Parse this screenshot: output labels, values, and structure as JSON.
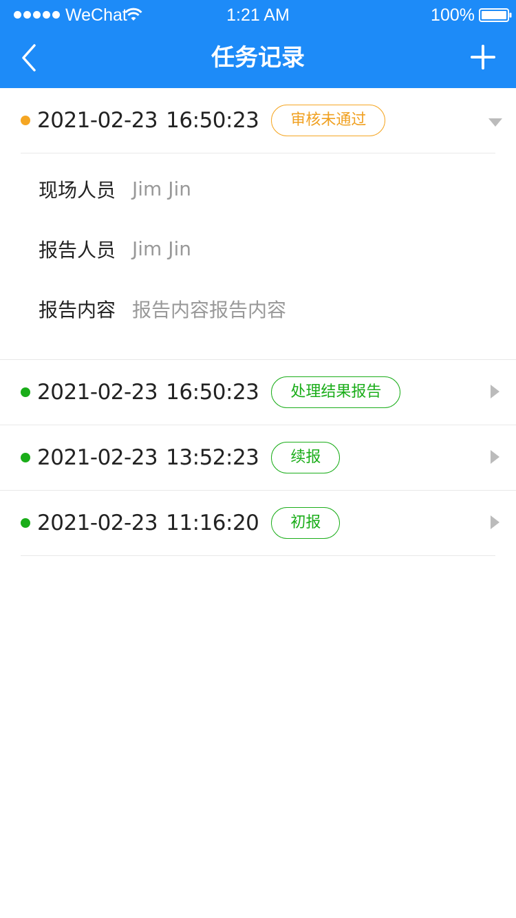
{
  "status_bar": {
    "carrier": "WeChat",
    "time": "1:21 AM",
    "battery": "100%"
  },
  "nav": {
    "title": "任务记录"
  },
  "records": [
    {
      "date": "2021-02-23",
      "time": "16:50:23",
      "badge": "审核未通过",
      "status_color": "#F5A623",
      "expanded": true
    },
    {
      "date": "2021-02-23",
      "time": "16:50:23",
      "badge": "处理结果报告",
      "status_color": "#1AAD19",
      "expanded": false
    },
    {
      "date": "2021-02-23",
      "time": "13:52:23",
      "badge": "续报",
      "status_color": "#1AAD19",
      "expanded": false
    },
    {
      "date": "2021-02-23",
      "time": "11:16:20",
      "badge": "初报",
      "status_color": "#1AAD19",
      "expanded": false
    }
  ],
  "details": [
    {
      "label": "现场人员",
      "value": "Jim Jin"
    },
    {
      "label": "报告人员",
      "value": "Jim Jin"
    },
    {
      "label": "报告内容",
      "value": "报告内容报告内容"
    }
  ],
  "colors": {
    "header": "#1D8BF8",
    "pending": "#F5A623",
    "success": "#1AAD19"
  }
}
